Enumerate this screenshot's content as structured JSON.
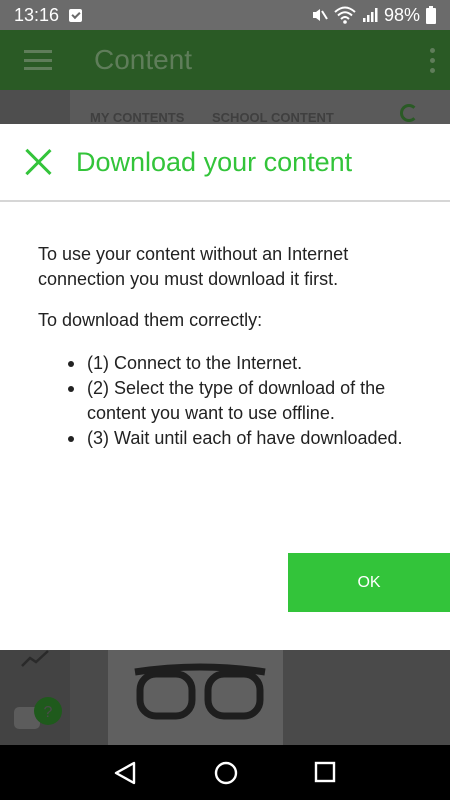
{
  "status_bar": {
    "time": "13:16",
    "battery": "98%",
    "icons": [
      "notification-icon",
      "mute-icon",
      "wifi-icon",
      "signal-icon",
      "battery-icon"
    ]
  },
  "app": {
    "title": "Content",
    "tabs": [
      "MY CONTENTS",
      "SCHOOL CONTENT"
    ]
  },
  "dialog": {
    "title": "Download your content",
    "intro": "To use your content without an Internet connection you must download it first.",
    "subheading": "To download them correctly:",
    "steps": [
      "(1) Connect to the Internet.",
      "(2) Select the type of download of the content you want to use offline.",
      "(3) Wait until each of have downloaded."
    ],
    "ok_label": "OK"
  },
  "colors": {
    "accent": "#33c43a",
    "app_bar_dimmed": "#2a5a25"
  }
}
